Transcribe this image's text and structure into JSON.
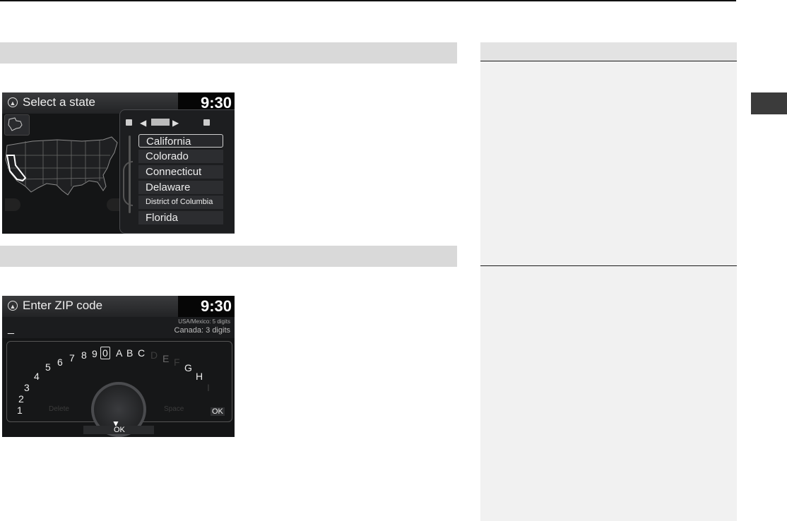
{
  "screen_state": {
    "title": "Select a state",
    "clock": "9:30",
    "states": [
      "California",
      "Colorado",
      "Connecticut",
      "Delaware",
      "District of Columbia",
      "Florida"
    ],
    "selected_index": 0
  },
  "screen_zip": {
    "title": "Enter ZIP code",
    "clock": "9:30",
    "cursor": "_",
    "hint_usa": "USA/Mexico: 5 digits",
    "hint_canada": "Canada: 3 digits",
    "chars": [
      "1",
      "2",
      "3",
      "4",
      "5",
      "6",
      "7",
      "8",
      "9",
      "0",
      "A",
      "B",
      "C",
      "D",
      "E",
      "F",
      "G",
      "H",
      "I"
    ],
    "selected_char": "0",
    "delete_label": "Delete",
    "space_label": "Space",
    "ok_label": "OK",
    "ok_bottom_label": "OK"
  }
}
